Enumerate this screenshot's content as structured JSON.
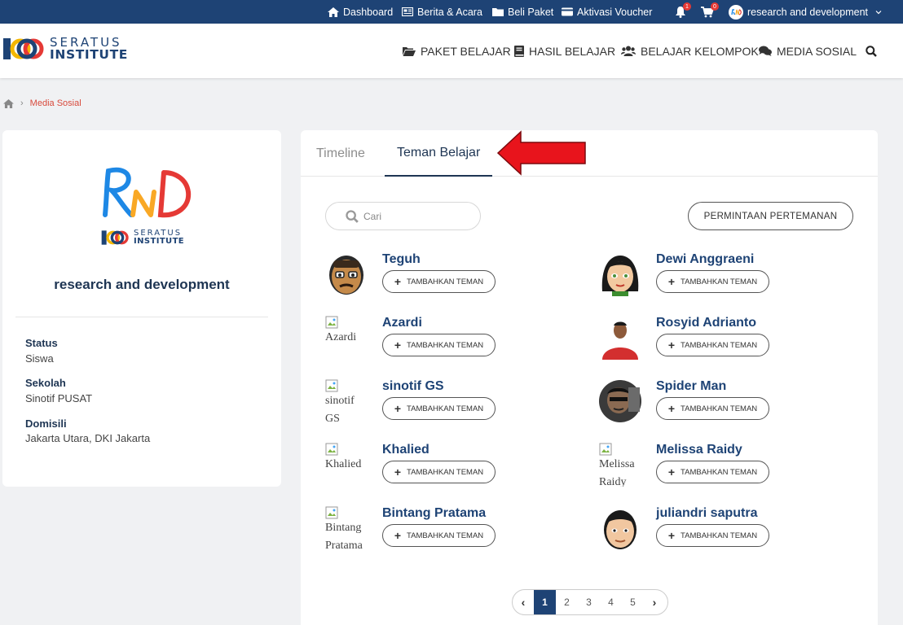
{
  "topbar": {
    "dashboard": "Dashboard",
    "berita": "Berita & Acara",
    "beli_paket": "Beli Paket",
    "aktivasi": "Aktivasi Voucher",
    "notif_count": "1",
    "cart_count": "0",
    "user": "research and development"
  },
  "header": {
    "logo_line1": "SERATUS",
    "logo_line2": "INSTITUTE",
    "nav": {
      "paket": "PAKET BELAJAR",
      "hasil": "HASIL BELAJAR",
      "kelompok": "BELAJAR KELOMPOK",
      "sosial": "MEDIA SOSIAL"
    }
  },
  "breadcrumb": {
    "current": "Media Sosial"
  },
  "profile": {
    "logo_line1": "SERATUS",
    "logo_line2": "INSTITUTE",
    "name": "research and development",
    "status_label": "Status",
    "status_value": "Siswa",
    "sekolah_label": "Sekolah",
    "sekolah_value": "Sinotif PUSAT",
    "domisili_label": "Domisili",
    "domisili_value": "Jakarta Utara, DKI Jakarta"
  },
  "tabs": {
    "timeline": "Timeline",
    "teman": "Teman Belajar"
  },
  "search": {
    "placeholder": "Cari"
  },
  "request_button": "PERMINTAAN PERTEMANAN",
  "add_label": "TAMBAHKAN TEMAN",
  "friends": [
    {
      "name": "Teguh",
      "alt": ""
    },
    {
      "name": "Dewi Anggraeni",
      "alt": ""
    },
    {
      "name": "Azardi",
      "alt": "Azardi"
    },
    {
      "name": "Rosyid Adrianto",
      "alt": ""
    },
    {
      "name": "sinotif GS",
      "alt": "sinotif GS"
    },
    {
      "name": "Spider Man",
      "alt": ""
    },
    {
      "name": "Khalied",
      "alt": "Khalied"
    },
    {
      "name": "Melissa Raidy",
      "alt": "Melissa Raidy"
    },
    {
      "name": "Bintang Pratama",
      "alt": "Bintang Pratama"
    },
    {
      "name": "juliandri saputra",
      "alt": ""
    }
  ],
  "pagination": {
    "prev": "‹",
    "pages": [
      "1",
      "2",
      "3",
      "4",
      "5"
    ],
    "next": "›",
    "current": "1"
  },
  "colors": {
    "navy": "#1e4375",
    "breadcrumb_active": "#d84a3c",
    "annotation_arrow": "#e8141c"
  }
}
